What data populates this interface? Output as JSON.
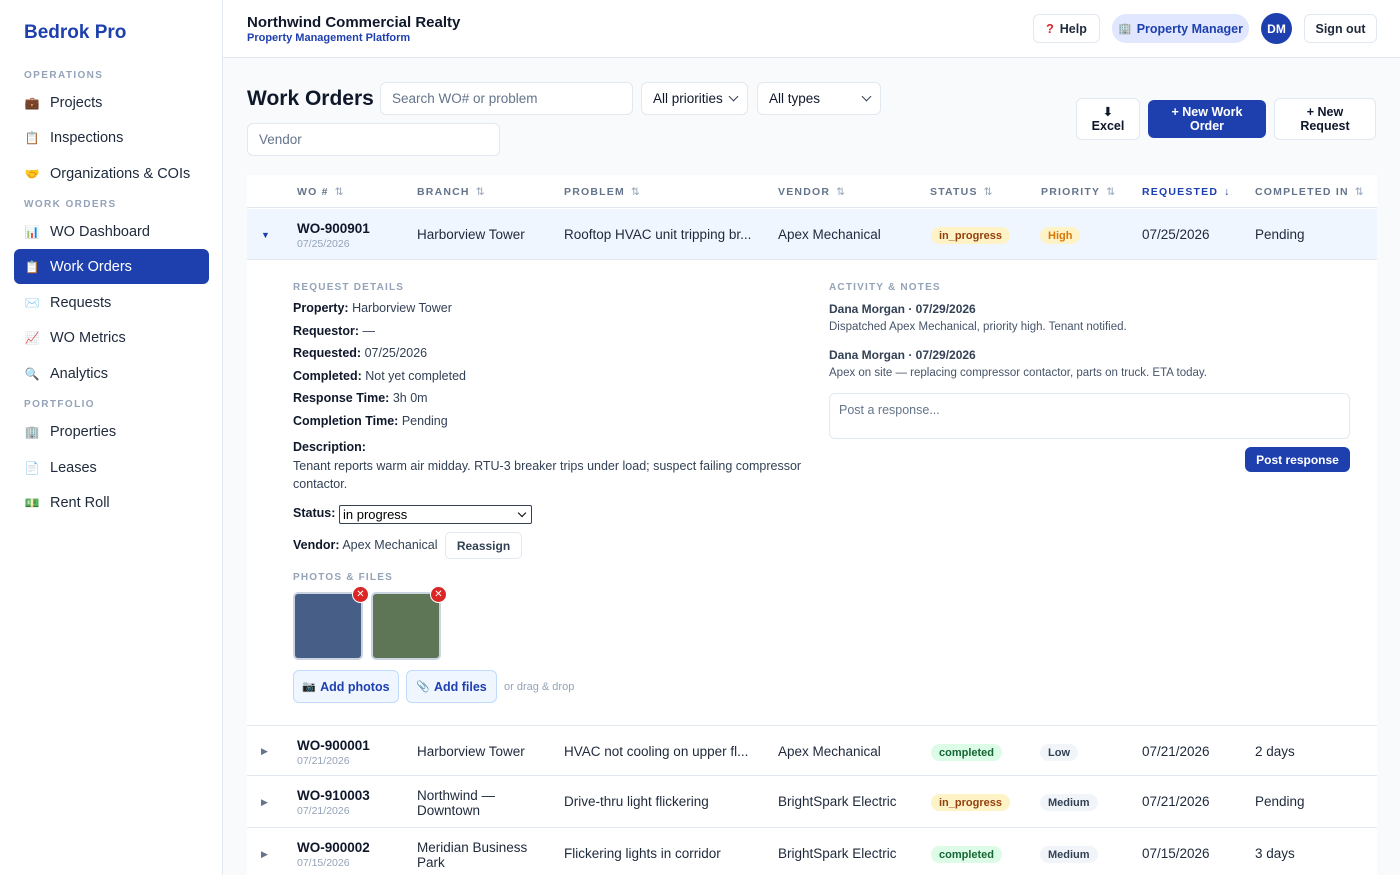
{
  "brand": "Bedrok Pro",
  "sidebar": {
    "sections": [
      {
        "label": "OPERATIONS"
      },
      {
        "label": "WORK ORDERS"
      },
      {
        "label": "PORTFOLIO"
      }
    ],
    "items": [
      {
        "label": "Projects",
        "icon": "briefcase-icon"
      },
      {
        "label": "Inspections",
        "icon": "clipboard-icon"
      },
      {
        "label": "Organizations & COIs",
        "icon": "handshake-icon"
      },
      {
        "label": "WO Dashboard",
        "icon": "bar-chart-icon"
      },
      {
        "label": "Work Orders",
        "icon": "clipboard-icon",
        "active": true
      },
      {
        "label": "Requests",
        "icon": "envelope-icon"
      },
      {
        "label": "WO Metrics",
        "icon": "line-chart-icon"
      },
      {
        "label": "Analytics",
        "icon": "magnifier-icon"
      },
      {
        "label": "Properties",
        "icon": "building-icon"
      },
      {
        "label": "Leases",
        "icon": "document-icon"
      },
      {
        "label": "Rent Roll",
        "icon": "money-icon"
      }
    ]
  },
  "header": {
    "company": "Northwind Commercial Realty",
    "platform": "Property Management Platform",
    "help_label": "Help",
    "role_label": "Property Manager",
    "avatar_initials": "DM",
    "signout_label": "Sign out"
  },
  "toolbar": {
    "title": "Work Orders",
    "search_placeholder": "Search WO# or problem",
    "priority_select": "All priorities",
    "type_select": "All types",
    "vendor_placeholder": "Vendor",
    "excel_icon": "⬇",
    "excel_label": "Excel",
    "new_wo_label": "+ New Work Order",
    "new_request_label": "+ New Request"
  },
  "table": {
    "columns": [
      "WO #",
      "BRANCH",
      "PROBLEM",
      "VENDOR",
      "STATUS",
      "PRIORITY",
      "REQUESTED",
      "COMPLETED IN"
    ],
    "sorted_column": "REQUESTED",
    "rows": [
      {
        "wo": "WO-900901",
        "date": "07/25/2026",
        "branch": "Harborview Tower",
        "problem": "Rooftop HVAC unit tripping br...",
        "vendor": "Apex Mechanical",
        "status": "in_progress",
        "priority": "High",
        "requested": "07/25/2026",
        "completed_in": "Pending",
        "expanded": true
      },
      {
        "wo": "WO-900001",
        "date": "07/21/2026",
        "branch": "Harborview Tower",
        "problem": "HVAC not cooling on upper fl...",
        "vendor": "Apex Mechanical",
        "status": "completed",
        "priority": "Low",
        "requested": "07/21/2026",
        "completed_in": "2 days"
      },
      {
        "wo": "WO-910003",
        "date": "07/21/2026",
        "branch": "Northwind — Downtown",
        "problem": "Drive-thru light flickering",
        "vendor": "BrightSpark Electric",
        "status": "in_progress",
        "priority": "Medium",
        "requested": "07/21/2026",
        "completed_in": "Pending"
      },
      {
        "wo": "WO-900002",
        "date": "07/15/2026",
        "branch": "Meridian Business Park",
        "problem": "Flickering lights in corridor",
        "vendor": "BrightSpark Electric",
        "status": "completed",
        "priority": "Medium",
        "requested": "07/15/2026",
        "completed_in": "3 days"
      }
    ]
  },
  "detail": {
    "request_details_label": "REQUEST DETAILS",
    "property_k": "Property:",
    "property_v": "Harborview Tower",
    "requestor_k": "Requestor:",
    "requestor_v": "—",
    "requested_k": "Requested:",
    "requested_v": "07/25/2026",
    "completed_k": "Completed:",
    "completed_v": "Not yet completed",
    "response_k": "Response Time:",
    "response_v": "3h 0m",
    "completion_k": "Completion Time:",
    "completion_v": "Pending",
    "description_k": "Description:",
    "description_v": "Tenant reports warm air midday. RTU-3 breaker trips under load; suspect failing compressor contactor.",
    "status_k": "Status:",
    "status_v": "in progress",
    "vendor_k": "Vendor:",
    "vendor_v": "Apex Mechanical",
    "reassign_label": "Reassign",
    "photos_label": "PHOTOS & FILES",
    "photo_colors": [
      "#475f86",
      "#5e7556"
    ],
    "add_photos_label": "Add photos",
    "add_files_label": "Add files",
    "drag_hint": "or drag & drop",
    "activity_label": "ACTIVITY & NOTES",
    "activity": [
      {
        "author": "Dana Morgan · 07/29/2026",
        "text": "Dispatched Apex Mechanical, priority high. Tenant notified."
      },
      {
        "author": "Dana Morgan · 07/29/2026",
        "text": "Apex on site — replacing compressor contactor, parts on truck. ETA today."
      }
    ],
    "response_placeholder": "Post a response...",
    "post_label": "Post response"
  },
  "colors": {
    "accent": "#1e40af",
    "danger": "#dc2626"
  }
}
